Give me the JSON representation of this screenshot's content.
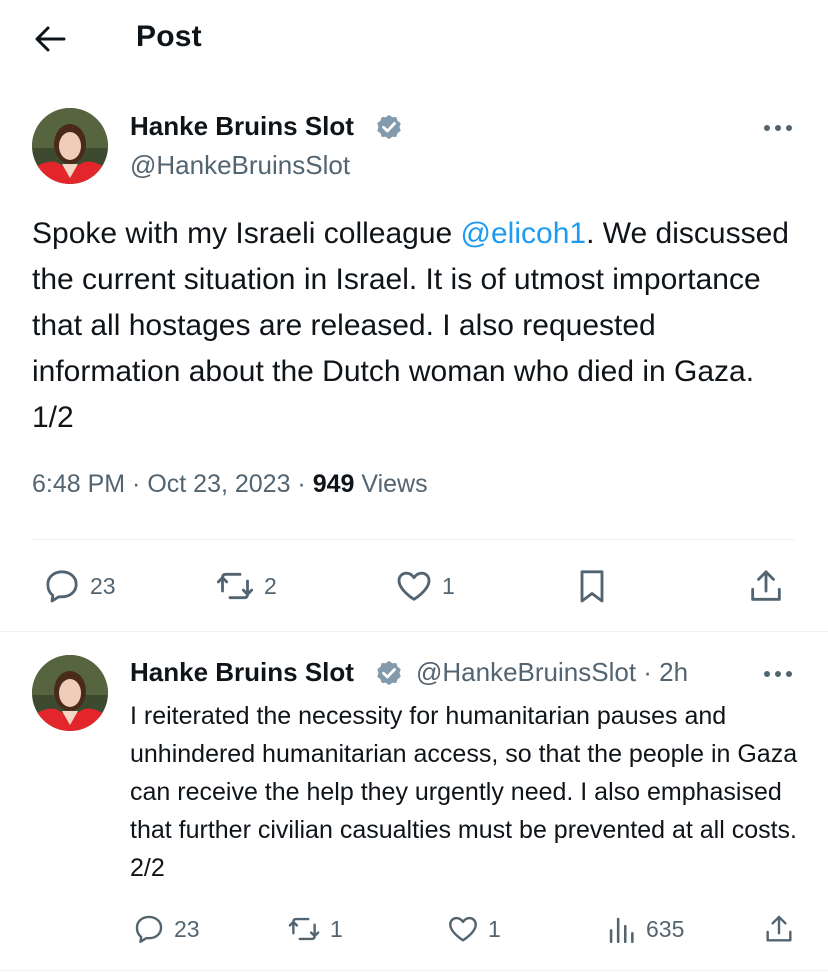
{
  "header": {
    "title": "Post"
  },
  "main_post": {
    "author_name": "Hanke Bruins Slot",
    "handle": "@HankeBruinsSlot",
    "text_before": "Spoke with my Israeli colleague ",
    "mention": "@elicoh1",
    "text_after": ". We discussed the current situation in Israel. It is of utmost importance that all hostages are released. I also requested information about the Dutch woman who died in Gaza. 1/2",
    "time": "6:48 PM",
    "date": "Oct 23, 2023",
    "views_count": "949",
    "views_label": "Views",
    "replies": "23",
    "reposts": "2",
    "likes": "1"
  },
  "reply_post": {
    "author_name": "Hanke Bruins Slot",
    "handle": "@HankeBruinsSlot",
    "age": "2h",
    "text": "I reiterated the necessity for humanitarian pauses and unhindered humanitarian access, so that the people in Gaza can receive the help they urgently need. I also emphasised that further civilian casualties must be prevented at all costs. 2/2",
    "replies": "23",
    "reposts": "1",
    "likes": "1",
    "views": "635"
  },
  "icons": {
    "back": "arrow-left-icon",
    "verified": "verified-badge-icon",
    "more": "more-horizontal-icon",
    "reply": "comment-icon",
    "repost": "repost-icon",
    "like": "heart-icon",
    "bookmark": "bookmark-icon",
    "share": "share-icon",
    "views": "views-chart-icon"
  },
  "colors": {
    "accent": "#1d9bf0",
    "secondary_text": "#536471",
    "primary_text": "#0f1419",
    "divider": "#eff3f4"
  }
}
